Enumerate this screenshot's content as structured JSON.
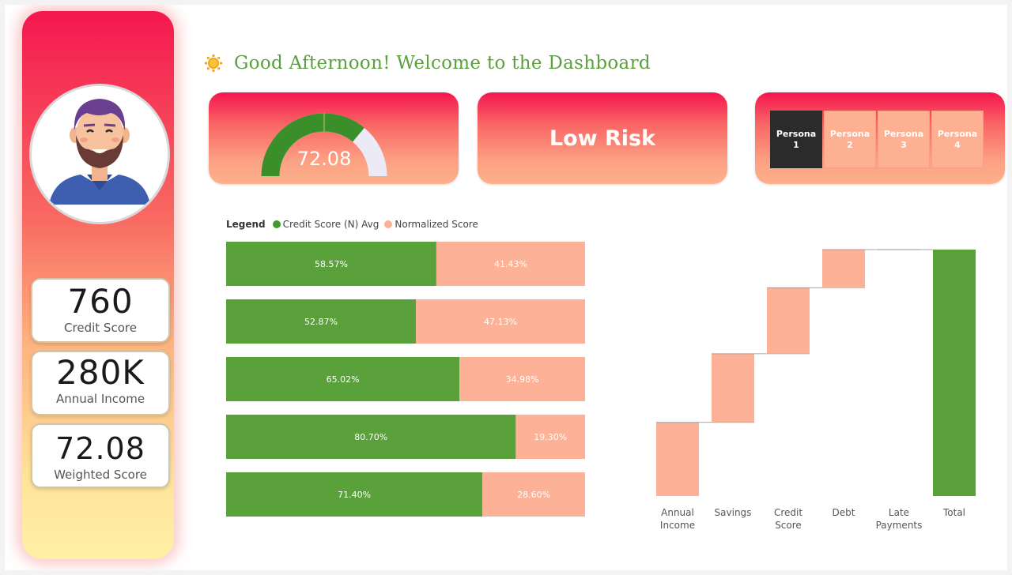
{
  "page_title": "Good Afternoon! Welcome to the Dashboard",
  "sidebar": {
    "kpis": [
      {
        "value": "760",
        "label": "Credit Score"
      },
      {
        "value": "280K",
        "label": "Annual Income"
      },
      {
        "value": "72.08",
        "label": "Weighted Score"
      }
    ]
  },
  "gauge": {
    "value": "72.08",
    "fraction": 0.7208,
    "color": "#3b8f2a",
    "track_color": "#ecebf5"
  },
  "risk": {
    "label": "Low Risk"
  },
  "personas": [
    {
      "line1": "Persona",
      "line2": "1",
      "selected": true
    },
    {
      "line1": "Persona",
      "line2": "2",
      "selected": false
    },
    {
      "line1": "Persona",
      "line2": "3",
      "selected": false
    },
    {
      "line1": "Persona",
      "line2": "4",
      "selected": false
    }
  ],
  "colors": {
    "green": "#5aa13b",
    "salmon": "#fdb196",
    "title_green": "#5aa13b"
  },
  "chart_data": [
    {
      "type": "bar",
      "orientation": "horizontal",
      "stacked": "100%",
      "legend": {
        "title": "Legend",
        "placement": "top-left"
      },
      "series": [
        {
          "name": "Credit Score (N) Avg",
          "color": "#5aa13b",
          "values": [
            58.57,
            52.87,
            65.02,
            80.7,
            71.4
          ],
          "labels": [
            "58.57%",
            "52.87%",
            "65.02%",
            "80.70%",
            "71.40%"
          ]
        },
        {
          "name": "Normalized Score",
          "color": "#fdb196",
          "values": [
            41.43,
            47.13,
            34.98,
            19.3,
            28.6
          ],
          "labels": [
            "41.43%",
            "47.13%",
            "34.98%",
            "19.30%",
            "28.60%"
          ]
        }
      ]
    },
    {
      "type": "bar",
      "subtype": "waterfall",
      "categories": [
        "Annual Income",
        "Savings",
        "Credit Score",
        "Debt",
        "Late Payments",
        "Total"
      ],
      "category_lines": [
        [
          "Annual",
          "Income"
        ],
        [
          "Savings"
        ],
        [
          "Credit",
          "Score"
        ],
        [
          "Debt"
        ],
        [
          "Late",
          "Payments"
        ],
        [
          "Total"
        ]
      ],
      "increments": [
        29,
        27,
        26,
        15,
        0,
        0
      ],
      "total": 97,
      "colors": {
        "increase": "#fdb196",
        "total": "#5aa13b"
      }
    }
  ]
}
